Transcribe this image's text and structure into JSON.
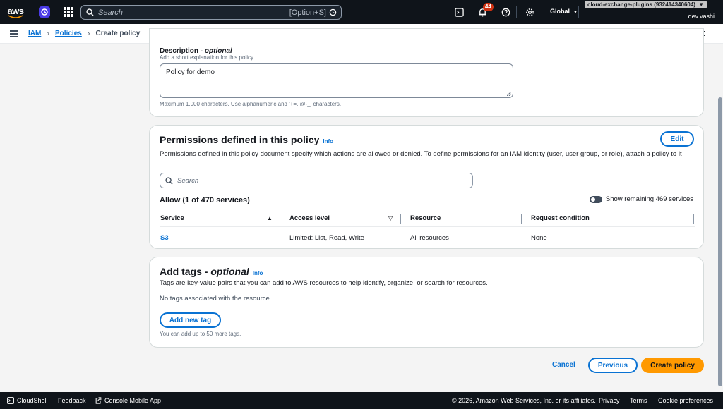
{
  "topnav": {
    "logo_text": "aws",
    "search_placeholder": "Search",
    "search_shortcut": "[Option+S]",
    "notification_count": "44",
    "region": "Global",
    "account": "cloud-exchange-plugins (932414340604)",
    "account_caret": "▼",
    "user": "dev.vashi"
  },
  "breadcrumb": {
    "items": [
      "IAM",
      "Policies"
    ],
    "current": "Create policy"
  },
  "description_section": {
    "label": "Description",
    "label_suffix": "optional",
    "hint": "Add a short explanation for this policy.",
    "value": "Policy for demo",
    "constraint": "Maximum 1,000 characters. Use alphanumeric and '+=,.@-_' characters."
  },
  "permissions": {
    "title": "Permissions defined in this policy",
    "info": "Info",
    "edit_label": "Edit",
    "description": "Permissions defined in this policy document specify which actions are allowed or denied. To define permissions for an IAM identity (user, user group, or role), attach a policy to it",
    "search_placeholder": "Search",
    "allow_title": "Allow (1 of 470 services)",
    "toggle_label": "Show remaining 469 services",
    "columns": [
      "Service",
      "Access level",
      "Resource",
      "Request condition"
    ],
    "sort_up": "▲",
    "sort_down": "▽",
    "rows": [
      {
        "service": "S3",
        "access": "Limited: List, Read, Write",
        "resource": "All resources",
        "condition": "None"
      }
    ]
  },
  "tags": {
    "title": "Add tags - ",
    "title_optional": "optional",
    "info": "Info",
    "description": "Tags are key-value pairs that you can add to AWS resources to help identify, organize, or search for resources.",
    "empty": "No tags associated with the resource.",
    "add_label": "Add new tag",
    "limit": "You can add up to 50 more tags."
  },
  "actions": {
    "cancel": "Cancel",
    "previous": "Previous",
    "create": "Create policy"
  },
  "footer": {
    "cloudshell": "CloudShell",
    "feedback": "Feedback",
    "mobile_app": "Console Mobile App",
    "copyright": "© 2026, Amazon Web Services, Inc. or its affiliates.",
    "privacy": "Privacy",
    "terms": "Terms",
    "cookies": "Cookie preferences"
  },
  "colors": {
    "nav_bg": "#0f141a",
    "link": "#0972d3",
    "primary": "#ff9900",
    "badge": "#d13212"
  }
}
